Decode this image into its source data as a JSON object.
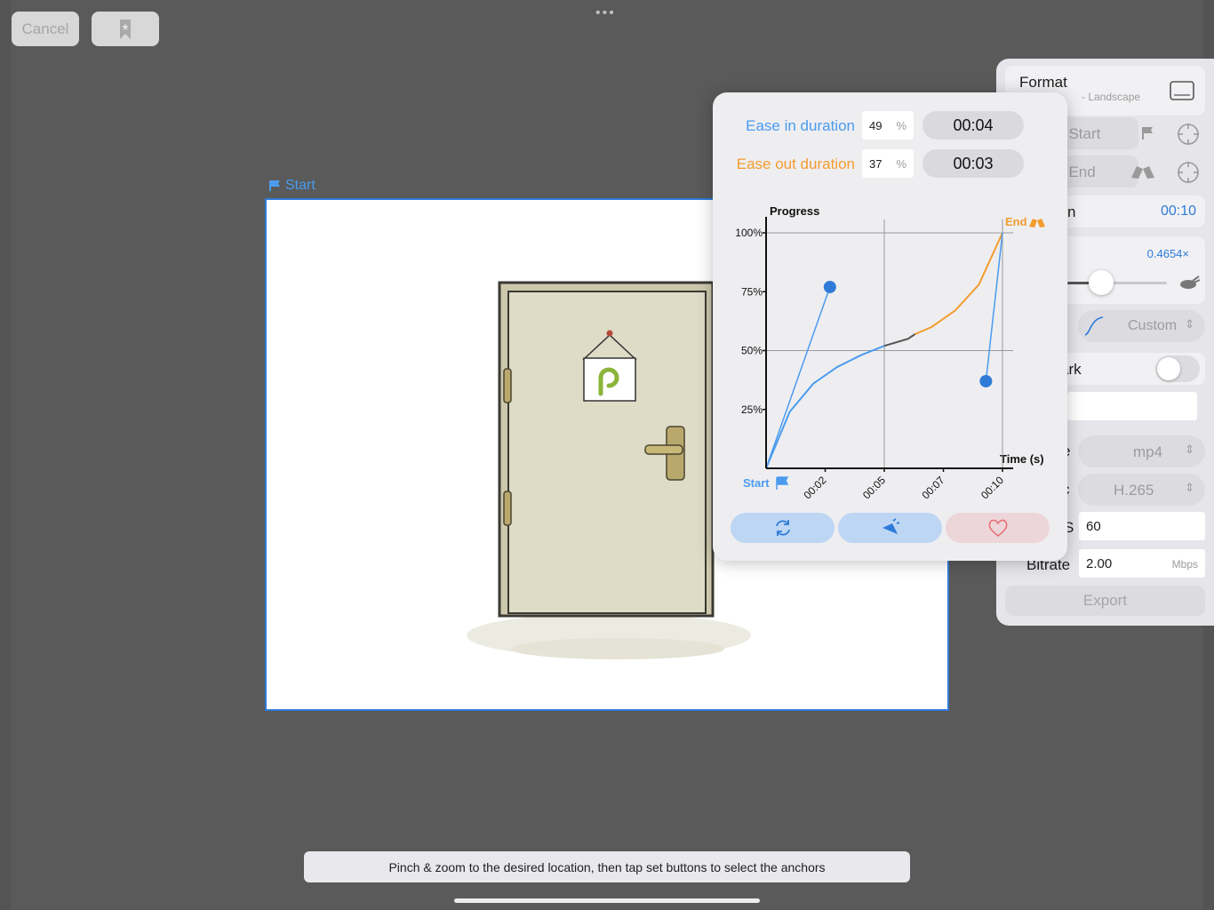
{
  "toolbar": {
    "cancel_label": "Cancel"
  },
  "canvas": {
    "start_tag": "Start"
  },
  "hint": {
    "text": "Pinch & zoom to the desired location, then tap set buttons to select the anchors"
  },
  "panel": {
    "format_title": "Format",
    "format_subtitle": "- Landscape",
    "set_start_label": "t Start",
    "set_end_label": "t End",
    "duration_label": "n",
    "duration_value": "00:10",
    "speed_value": "0.4654×",
    "speed_level": 0.4654,
    "curve_value": "Custom",
    "watermark_label": "ark",
    "watermark_on": false,
    "file_type_label": "e",
    "file_type_value": "mp4",
    "codec_label": "c",
    "codec_value": "H.265",
    "fps_label": "S",
    "fps_value": "60",
    "bitrate_label": "Bitrate",
    "bitrate_value": "2.00",
    "bitrate_unit": "Mbps",
    "export_label": "Export"
  },
  "ease": {
    "in_label": "Ease in duration",
    "in_pct": "49",
    "in_time": "00:04",
    "out_label": "Ease out duration",
    "out_pct": "37",
    "out_time": "00:03",
    "pct_unit": "%"
  },
  "colors": {
    "ease_in": "#4a9bef",
    "ease_out": "#f39c2f",
    "accent": "#2f7bd8",
    "heart": "#e9707a"
  },
  "chart_data": {
    "type": "line",
    "ylabel": "Progress",
    "xlabel": "Time (s)",
    "ytick_labels": [
      "25%",
      "50%",
      "75%",
      "100%"
    ],
    "xtick_labels": [
      "00:02",
      "00:05",
      "00:07",
      "00:10"
    ],
    "start_label": "Start",
    "end_label": "End",
    "xlim": [
      0,
      10
    ],
    "ylim": [
      0,
      100
    ],
    "curve": [
      [
        0,
        0
      ],
      [
        1,
        24
      ],
      [
        2,
        36
      ],
      [
        3,
        43
      ],
      [
        4,
        48
      ],
      [
        5,
        52
      ],
      [
        6,
        55
      ],
      [
        6.3,
        57
      ],
      [
        7,
        60
      ],
      [
        8,
        67
      ],
      [
        9,
        78
      ],
      [
        10,
        100
      ]
    ],
    "control_points": [
      [
        2.7,
        77
      ],
      [
        9.3,
        37
      ]
    ]
  }
}
